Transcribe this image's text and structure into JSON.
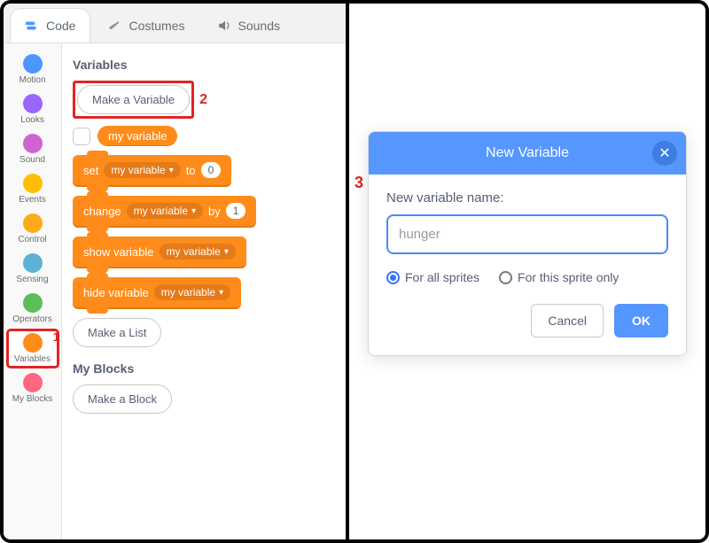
{
  "annotations": {
    "cat_variables": "1",
    "make_variable": "2",
    "dialog": "3"
  },
  "colors": {
    "motion": "#4c97ff",
    "looks": "#9966ff",
    "sound": "#cf63cf",
    "events": "#ffbf00",
    "control": "#ffab19",
    "sensing": "#5cb1d6",
    "operators": "#59c059",
    "variables": "#ff8c1a",
    "myblocks": "#ff6680",
    "accent": "#5596ff",
    "highlight": "#e02424"
  },
  "tabs": {
    "code": "Code",
    "costumes": "Costumes",
    "sounds": "Sounds"
  },
  "categories": [
    {
      "key": "motion",
      "label": "Motion"
    },
    {
      "key": "looks",
      "label": "Looks"
    },
    {
      "key": "sound",
      "label": "Sound"
    },
    {
      "key": "events",
      "label": "Events"
    },
    {
      "key": "control",
      "label": "Control"
    },
    {
      "key": "sensing",
      "label": "Sensing"
    },
    {
      "key": "operators",
      "label": "Operators"
    },
    {
      "key": "variables",
      "label": "Variables"
    },
    {
      "key": "myblocks",
      "label": "My Blocks"
    }
  ],
  "palette": {
    "variables_title": "Variables",
    "make_variable": "Make a Variable",
    "var_name": "my variable",
    "set_pre": "set",
    "set_post": "to",
    "set_val": "0",
    "change_pre": "change",
    "change_post": "by",
    "change_val": "1",
    "show_pre": "show variable",
    "hide_pre": "hide variable",
    "make_list": "Make a List",
    "myblocks_title": "My Blocks",
    "make_block": "Make a Block"
  },
  "dialog": {
    "title": "New Variable",
    "label": "New variable name:",
    "value": "hunger",
    "opt_all": "For all sprites",
    "opt_this": "For this sprite only",
    "cancel": "Cancel",
    "ok": "OK",
    "scope_selected": "all"
  }
}
